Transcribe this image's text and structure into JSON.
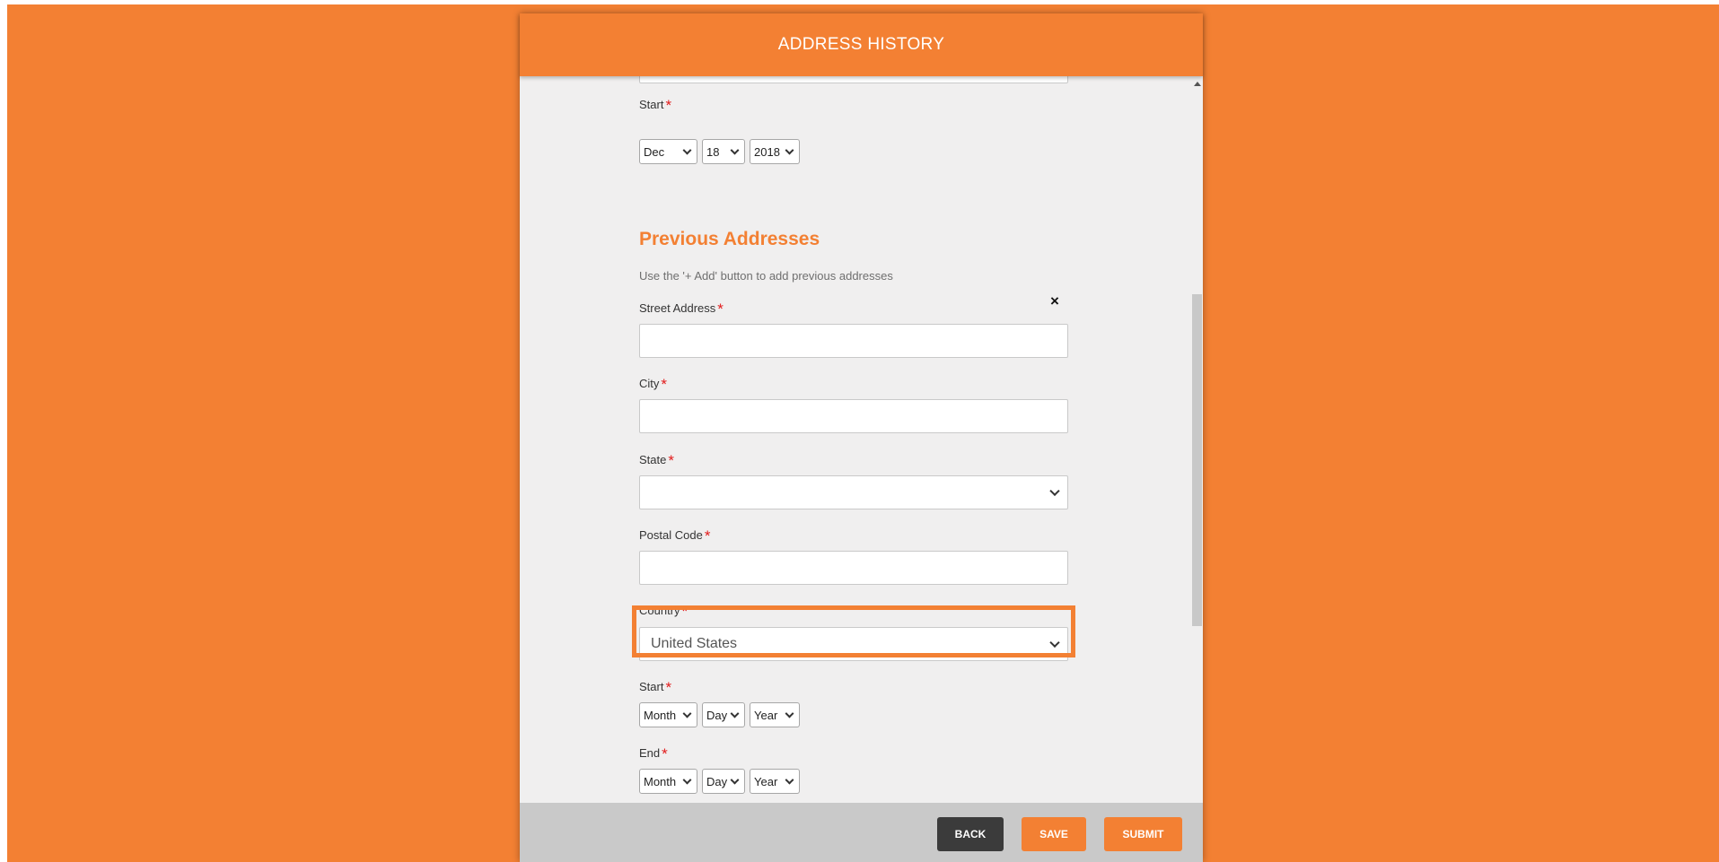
{
  "header": {
    "title": "ADDRESS HISTORY"
  },
  "current_address": {
    "start_label": "Start",
    "start_month": "Dec",
    "start_day": "18",
    "start_year": "2018"
  },
  "previous": {
    "title": "Previous Addresses",
    "help": "Use the '+ Add' button to add previous addresses",
    "remove_icon": "×",
    "street_label": "Street Address",
    "street_value": "",
    "city_label": "City",
    "city_value": "",
    "state_label": "State",
    "state_value": "",
    "postal_label": "Postal Code",
    "postal_value": "",
    "country_label": "Country",
    "country_value": "United States",
    "start_label": "Start",
    "end_label": "End",
    "month_placeholder": "Month",
    "day_placeholder": "Day",
    "year_placeholder": "Year"
  },
  "required_marker": "*",
  "footer": {
    "back_label": "BACK",
    "save_label": "SAVE",
    "submit_label": "SUBMIT"
  },
  "colors": {
    "brand": "#f38033",
    "required": "#e21b1b",
    "back_button": "#3b3b3b"
  }
}
